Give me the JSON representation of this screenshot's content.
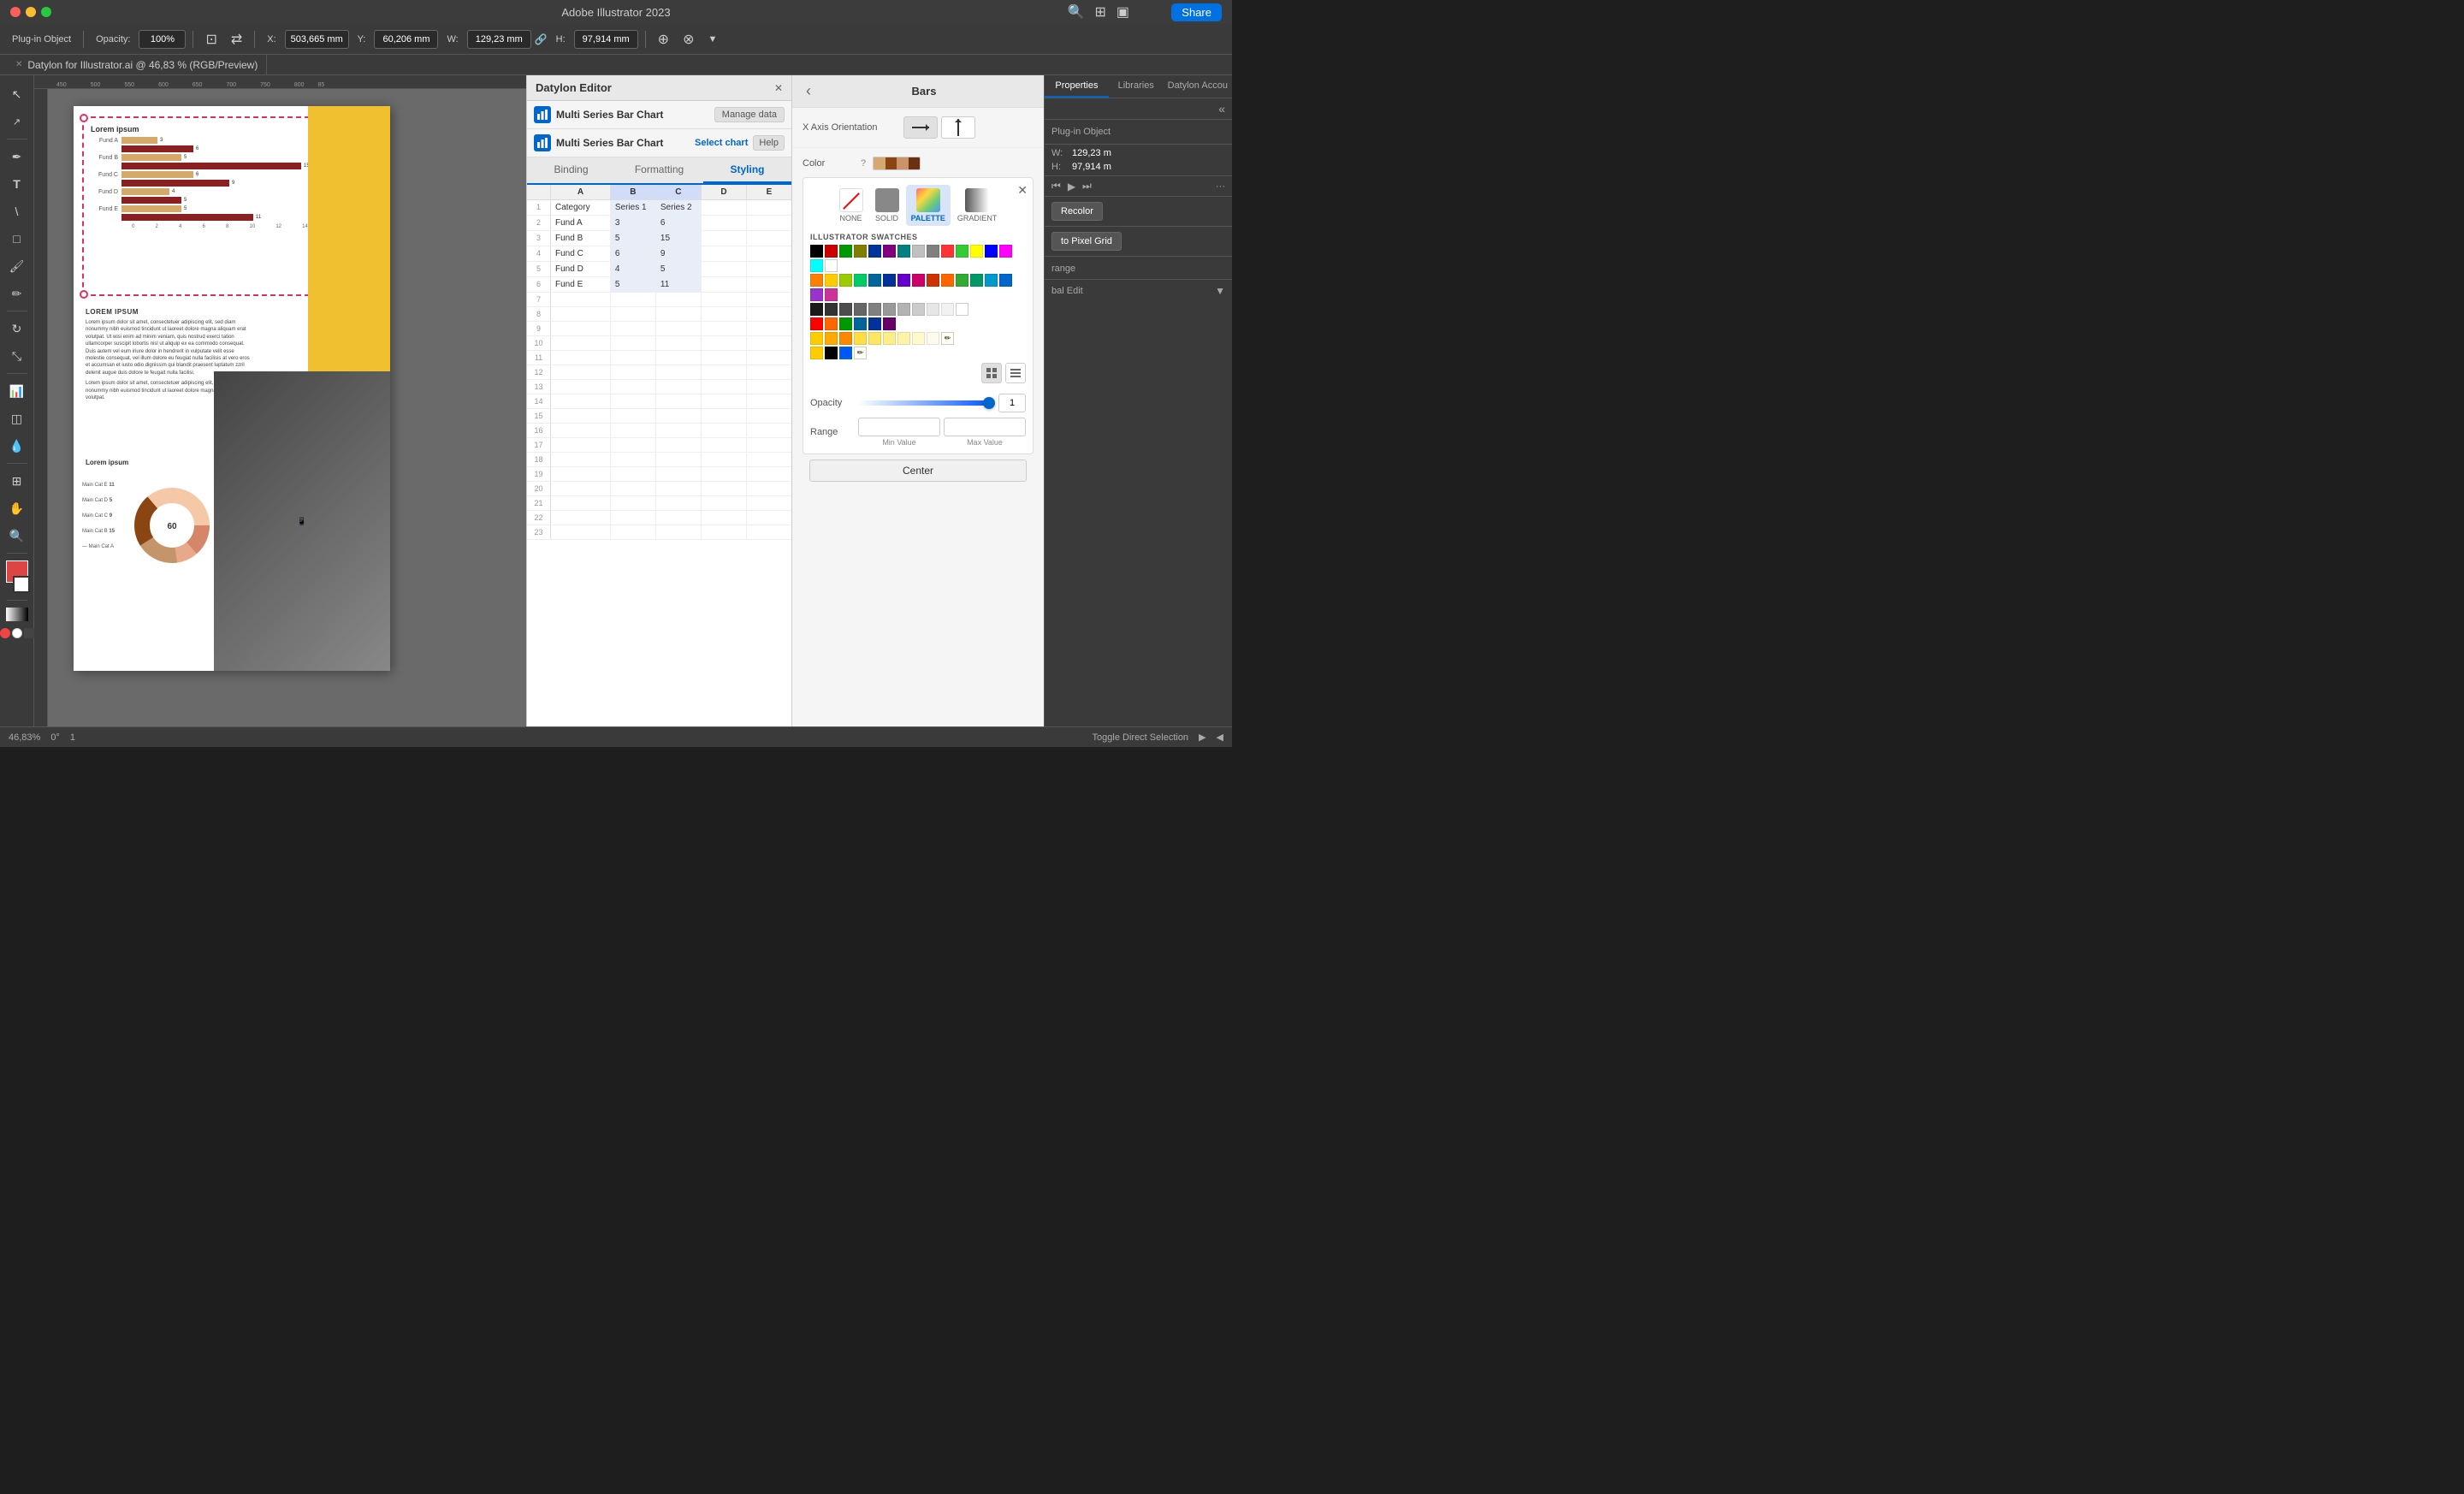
{
  "titlebar": {
    "title": "Adobe Illustrator 2023",
    "share_label": "Share"
  },
  "toolbar": {
    "plugin_object": "Plug-in Object",
    "opacity_label": "Opacity:",
    "opacity_value": "100%",
    "x_label": "X:",
    "x_value": "503,665 mm",
    "y_label": "Y:",
    "y_value": "60,206 mm",
    "w_label": "W:",
    "w_value": "129,23 mm",
    "h_label": "H:",
    "h_value": "97,914 mm"
  },
  "tab": {
    "title": "Datylon for Illustrator.ai @ 46,83 % (RGB/Preview)"
  },
  "statusbar": {
    "zoom": "46,83%",
    "angle": "0°",
    "page": "1",
    "mode": "Toggle Direct Selection"
  },
  "canvas": {
    "chart_title": "Lorem ipsum",
    "lorem_heading": "LOREM IPSUM",
    "lorem_body": "Lorem ipsum dolor sit amet, consectetuer adipiscing elit, sed diam nonummy nibh euismod tincidunt ut laoreet dolore magna aliquam erat volutpat. Ut wisi enim ad minim veniam, quis nostrud exerci tation ullamcorper suscipit lobortis nisl ut aliquip ex ea commodo consequat. Duis autem vel eum iriure dolor in hendrerit in vulputate velit esse molestie consequat, vel illum dolore eu feugiat nulla facilisis at vero eros et accumsan et iusto odio dignissim qui blandit praesent luptatum zzril delenit augue duis dolore te feugait nulla facilisi.\nLorem ipsum dolor sit amet, consectetuer adipiscing elit, sed diam nonummy nibh euismod tincidunt ut laoreet dolore magna aliquam erat volutpat.",
    "lorem_title2": "Lorem ipsum",
    "funds": [
      "Fund A",
      "Fund B",
      "Fund C",
      "Fund D",
      "Fund E"
    ],
    "series1": [
      3,
      5,
      6,
      4,
      5
    ],
    "series2": [
      6,
      15,
      9,
      5,
      11
    ],
    "donut_title": "",
    "donut_labels": [
      "Main Cat E",
      "Main Cat D",
      "Main Cat C",
      "Main Cat B",
      "Main Cat A"
    ],
    "donut_values": [
      11,
      5,
      9,
      15,
      60
    ]
  },
  "editor": {
    "header_title": "Datylon Editor",
    "chart_name": "Multi Series Bar Chart",
    "manage_data_btn": "Manage data",
    "select_chart_btn": "Select chart",
    "help_btn": "Help",
    "tabs": [
      "Binding",
      "Formatting",
      "Styling"
    ],
    "active_tab": "Styling",
    "grid_cols": [
      "",
      "A",
      "B",
      "C",
      "D",
      "E"
    ],
    "grid_rows": [
      {
        "n": 1,
        "a": "Category",
        "b": "Series 1",
        "c": "Series 2",
        "d": "",
        "e": ""
      },
      {
        "n": 2,
        "a": "Fund A",
        "b": "3",
        "c": "6",
        "d": "",
        "e": ""
      },
      {
        "n": 3,
        "a": "Fund B",
        "b": "5",
        "c": "15",
        "d": "",
        "e": ""
      },
      {
        "n": 4,
        "a": "Fund C",
        "b": "6",
        "c": "9",
        "d": "",
        "e": ""
      },
      {
        "n": 5,
        "a": "Fund D",
        "b": "4",
        "c": "5",
        "d": "",
        "e": ""
      },
      {
        "n": 6,
        "a": "Fund E",
        "b": "5",
        "c": "11",
        "d": "",
        "e": ""
      },
      {
        "n": 7,
        "a": "",
        "b": "",
        "c": "",
        "d": "",
        "e": ""
      },
      {
        "n": 8,
        "a": "",
        "b": "",
        "c": "",
        "d": "",
        "e": ""
      },
      {
        "n": 9,
        "a": "",
        "b": "",
        "c": "",
        "d": "",
        "e": ""
      },
      {
        "n": 10,
        "a": "",
        "b": "",
        "c": "",
        "d": "",
        "e": ""
      },
      {
        "n": 11,
        "a": "",
        "b": "",
        "c": "",
        "d": "",
        "e": ""
      },
      {
        "n": 12,
        "a": "",
        "b": "",
        "c": "",
        "d": "",
        "e": ""
      },
      {
        "n": 13,
        "a": "",
        "b": "",
        "c": "",
        "d": "",
        "e": ""
      },
      {
        "n": 14,
        "a": "",
        "b": "",
        "c": "",
        "d": "",
        "e": ""
      },
      {
        "n": 15,
        "a": "",
        "b": "",
        "c": "",
        "d": "",
        "e": ""
      },
      {
        "n": 16,
        "a": "",
        "b": "",
        "c": "",
        "d": "",
        "e": ""
      },
      {
        "n": 17,
        "a": "",
        "b": "",
        "c": "",
        "d": "",
        "e": ""
      },
      {
        "n": 18,
        "a": "",
        "b": "",
        "c": "",
        "d": "",
        "e": ""
      },
      {
        "n": 19,
        "a": "",
        "b": "",
        "c": "",
        "d": "",
        "e": ""
      },
      {
        "n": 20,
        "a": "",
        "b": "",
        "c": "",
        "d": "",
        "e": ""
      },
      {
        "n": 21,
        "a": "",
        "b": "",
        "c": "",
        "d": "",
        "e": ""
      },
      {
        "n": 22,
        "a": "",
        "b": "",
        "c": "",
        "d": "",
        "e": ""
      },
      {
        "n": 23,
        "a": "",
        "b": "",
        "c": "",
        "d": "",
        "e": ""
      }
    ]
  },
  "styling_panel": {
    "back_btn": "‹",
    "title": "Bars",
    "x_axis_label": "X Axis Orientation",
    "color_label": "Color",
    "color_help": "?",
    "none_label": "NONE",
    "solid_label": "SOLID",
    "palette_label": "PALETTE",
    "gradient_label": "GRADIENT",
    "swatches_title": "ILLUSTRATOR SWATCHES",
    "opacity_label": "Opacity",
    "opacity_value": "1",
    "range_label": "Range",
    "min_value_label": "Min Value",
    "max_value_label": "Max Value",
    "center_btn": "Center"
  },
  "properties": {
    "tabs": [
      "Properties",
      "Libraries",
      "Datylon Accou"
    ],
    "plugin_object_label": "Plug-in Object",
    "w_label": "W:",
    "w_value": "129,23 m",
    "h_label": "H:",
    "h_value": "97,914 m",
    "recolor_btn": "Recolor",
    "pixel_grid_btn": "to Pixel Grid",
    "range_btn": "range",
    "global_edit_btn": "bal Edit"
  },
  "swatches": {
    "row1": [
      "#000000",
      "#800000",
      "#008000",
      "#808000",
      "#000080",
      "#800080",
      "#008080",
      "#c0c0c0",
      "#808080",
      "#ff0000",
      "#00ff00",
      "#ffff00",
      "#0000ff",
      "#ff00ff",
      "#00ffff",
      "#ffffff"
    ],
    "row2": [
      "#ff8000",
      "#ffcc00",
      "#ccff00",
      "#80ff00",
      "#00ff80",
      "#00ffcc",
      "#00ccff",
      "#0080ff",
      "#8000ff",
      "#cc00ff",
      "#ff0080",
      "#ff0000",
      "#cc3300",
      "#ff6600",
      "#ff9900",
      "#ffcc00"
    ],
    "grays": [
      "#1a1a1a",
      "#333333",
      "#4d4d4d",
      "#666666",
      "#808080",
      "#999999",
      "#b3b3b3",
      "#cccccc",
      "#e6e6e6",
      "#f2f2f2",
      "#ffffff"
    ],
    "reds": [
      "#ff0000",
      "#ff6600",
      "#009900",
      "#006699",
      "#003399",
      "#660066"
    ],
    "yellows": [
      "#ffcc00",
      "#ffaa00",
      "#ff8800",
      "#ffdd00",
      "#ffe566",
      "#ffee99",
      "#fff5cc",
      "#fffae6",
      "#ffffff"
    ],
    "bottom": [
      "#ffcc00",
      "#000000"
    ]
  }
}
